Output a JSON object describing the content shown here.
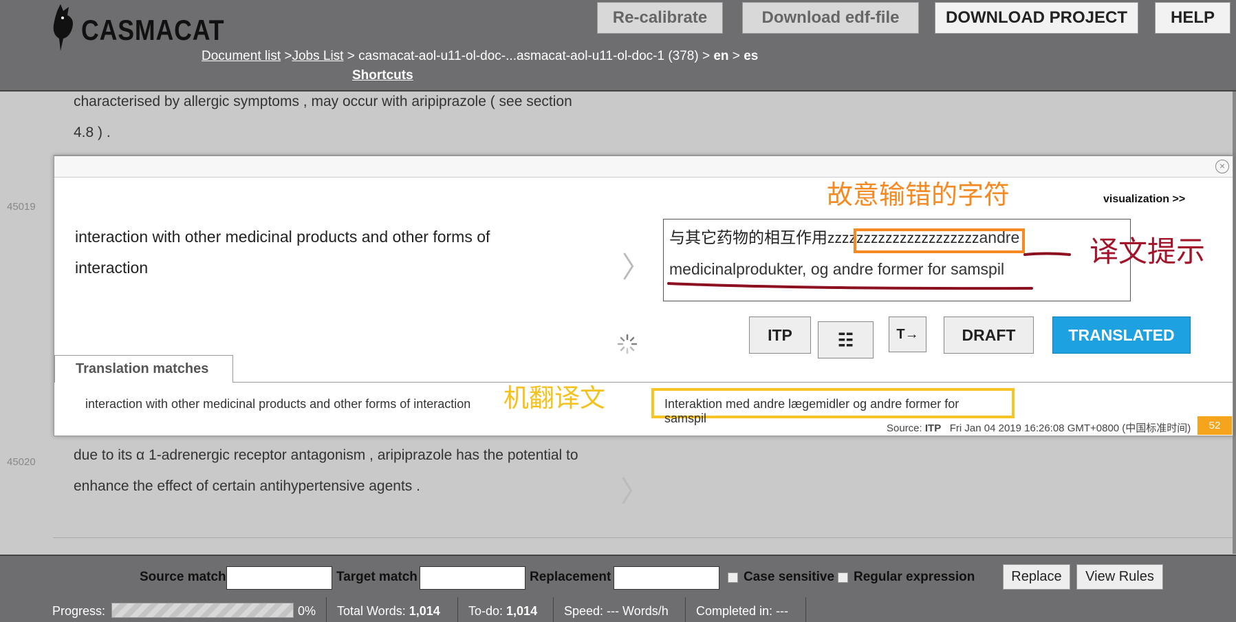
{
  "header": {
    "logo_text": "CASMACAT",
    "buttons": {
      "recalibrate": "Re-calibrate",
      "download_edf": "Download edf-file",
      "download_project": "DOWNLOAD PROJECT",
      "help": "HELP"
    },
    "breadcrumb": {
      "document_list": "Document list",
      "sep1": " >",
      "jobs_list": "Jobs List",
      "sep2": " > casmacat-aol-u11-ol-doc-...asmacat-aol-u11-ol-doc-1 (378) > ",
      "src_lang": "en",
      "sep3": " > ",
      "tgt_lang": "es"
    },
    "shortcuts": "Shortcuts"
  },
  "segments": {
    "prev_text_line1": "characterised by allergic symptoms , may occur with aripiprazole ( see section",
    "prev_text_line2": "4.8 ) .",
    "active_id": "45019",
    "next_id": "45020",
    "next_text_line1": "due to its α 1-adrenergic receptor antagonism , aripiprazole has the potential to",
    "next_text_line2": "enhance the effect of certain antihypertensive agents ."
  },
  "active": {
    "source_line1": "interaction with other medicinal products and other forms of",
    "source_line2": "interaction",
    "visualization_link": "visualization >>",
    "target_typed": "与其它药物的相互作用",
    "target_error": "zzzzzzzzzzzzzzzzzzzzz",
    "target_suggestion_line1": "andre",
    "target_suggestion_line2": "medicinalprodukter, og andre former for samspil",
    "buttons": {
      "itp": "ITP",
      "draft": "DRAFT",
      "translated": "TRANSLATED"
    },
    "matches_tab": "Translation matches",
    "match_source": "interaction with other medicinal products and other forms of interaction",
    "match_target": "Interaktion med andre lægemidler og andre former for samspil",
    "source_label": "Source: ",
    "source_value": "ITP",
    "timestamp": "Fri Jan 04 2019 16:26:08 GMT+0800 (中国标准时间)",
    "match_score": "52"
  },
  "annotations": {
    "wrong_chars": "故意输错的字符",
    "translation_hint": "译文提示",
    "machine_translation": "机翻译文"
  },
  "replace_bar": {
    "source_match": "Source match",
    "target_match": "Target match",
    "replacement": "Replacement",
    "case_sensitive": "Case sensitive",
    "regex": "Regular expression",
    "replace_btn": "Replace",
    "view_rules_btn": "View Rules"
  },
  "status": {
    "progress_label": "Progress:",
    "progress_pct": "0%",
    "progress_fraction": 0,
    "total_words_label": "Total Words: ",
    "total_words": "1,014",
    "todo_label": "To-do: ",
    "todo": "1,014",
    "speed": "Speed: --- Words/h",
    "completed": "Completed in: ---"
  },
  "colors": {
    "header_bg": "#6e6e70",
    "translated_blue": "#1da1e1",
    "annotation_orange": "#f58a22",
    "annotation_red": "#a3132a",
    "annotation_yellow": "#f5c11d",
    "badge_orange": "#f5a41c"
  }
}
